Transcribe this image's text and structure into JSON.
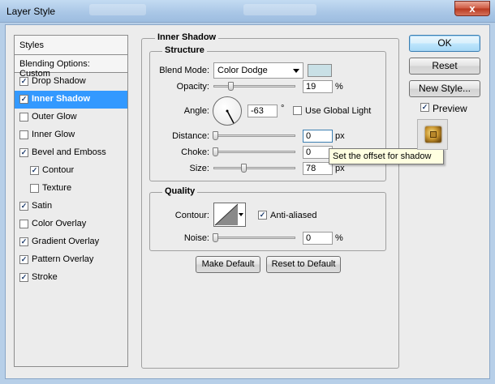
{
  "window": {
    "title": "Layer Style",
    "close_glyph": "x"
  },
  "sidebar": {
    "header": "Styles",
    "blending_options": "Blending Options: Custom",
    "items": [
      {
        "label": "Drop Shadow",
        "checked": true
      },
      {
        "label": "Inner Shadow",
        "checked": true,
        "selected": true
      },
      {
        "label": "Outer Glow",
        "checked": false
      },
      {
        "label": "Inner Glow",
        "checked": false
      },
      {
        "label": "Bevel and Emboss",
        "checked": true
      },
      {
        "label": "Contour",
        "checked": true,
        "sub": true
      },
      {
        "label": "Texture",
        "checked": false,
        "sub": true
      },
      {
        "label": "Satin",
        "checked": true
      },
      {
        "label": "Color Overlay",
        "checked": false
      },
      {
        "label": "Gradient Overlay",
        "checked": true
      },
      {
        "label": "Pattern Overlay",
        "checked": true
      },
      {
        "label": "Stroke",
        "checked": true
      }
    ]
  },
  "panel": {
    "title": "Inner Shadow",
    "structure": {
      "title": "Structure",
      "blend_mode_label": "Blend Mode:",
      "blend_mode_value": "Color Dodge",
      "shadow_color": "#c9e0e6",
      "opacity_label": "Opacity:",
      "opacity_value": "19",
      "opacity_unit": "%",
      "angle_label": "Angle:",
      "angle_value": "-63",
      "angle_unit": "°",
      "use_global_light_label": "Use Global Light",
      "use_global_light_checked": false,
      "distance_label": "Distance:",
      "distance_value": "0",
      "distance_unit": "px",
      "choke_label": "Choke:",
      "choke_value": "0",
      "choke_unit": "%",
      "size_label": "Size:",
      "size_value": "78",
      "size_unit": "px"
    },
    "quality": {
      "title": "Quality",
      "contour_label": "Contour:",
      "anti_aliased_label": "Anti-aliased",
      "anti_aliased_checked": true,
      "noise_label": "Noise:",
      "noise_value": "0",
      "noise_unit": "%"
    },
    "make_default": "Make Default",
    "reset_to_default": "Reset to Default"
  },
  "tooltip": "Set the offset for shadow",
  "actions": {
    "ok": "OK",
    "reset": "Reset",
    "new_style": "New Style...",
    "preview_label": "Preview",
    "preview_checked": true
  },
  "colors": {
    "selection": "#3399ff",
    "titlebar": "#a9c6e6",
    "close": "#c8442b",
    "ok_accent": "#a7d9f5"
  }
}
